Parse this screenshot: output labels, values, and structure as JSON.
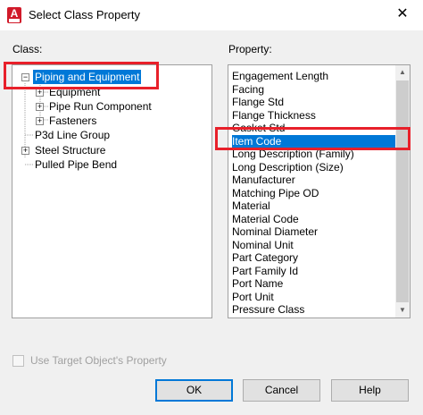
{
  "window": {
    "title": "Select Class Property",
    "close_glyph": "✕",
    "app_icon_letter": "A"
  },
  "labels": {
    "class": "Class:",
    "property": "Property:"
  },
  "tree": {
    "items": [
      {
        "label": "Piping and Equipment",
        "expander": "−",
        "selected": true
      },
      {
        "label": "Equipment",
        "expander": "+"
      },
      {
        "label": "Pipe Run Component",
        "expander": "+"
      },
      {
        "label": "Fasteners",
        "expander": "+"
      },
      {
        "label": "P3d Line Group",
        "expander": ""
      },
      {
        "label": "Steel Structure",
        "expander": "+"
      },
      {
        "label": "Pulled Pipe Bend",
        "expander": ""
      }
    ]
  },
  "properties": {
    "items": [
      "Engagement Length",
      "Facing",
      "Flange Std",
      "Flange Thickness",
      "Gasket Std",
      "Item Code",
      "Long Description (Family)",
      "Long Description (Size)",
      "Manufacturer",
      "Matching Pipe OD",
      "Material",
      "Material Code",
      "Nominal Diameter",
      "Nominal Unit",
      "Part Category",
      "Part Family Id",
      "Port Name",
      "Port Unit",
      "Pressure Class"
    ],
    "selected": "Item Code",
    "scroll_up_glyph": "▲",
    "scroll_down_glyph": "▼"
  },
  "checkbox": {
    "label": "Use Target Object's Property",
    "checked": false,
    "enabled": false
  },
  "buttons": {
    "ok": "OK",
    "cancel": "Cancel",
    "help": "Help"
  },
  "colors": {
    "selection": "#0078d7",
    "highlight_box": "#e8202a"
  }
}
